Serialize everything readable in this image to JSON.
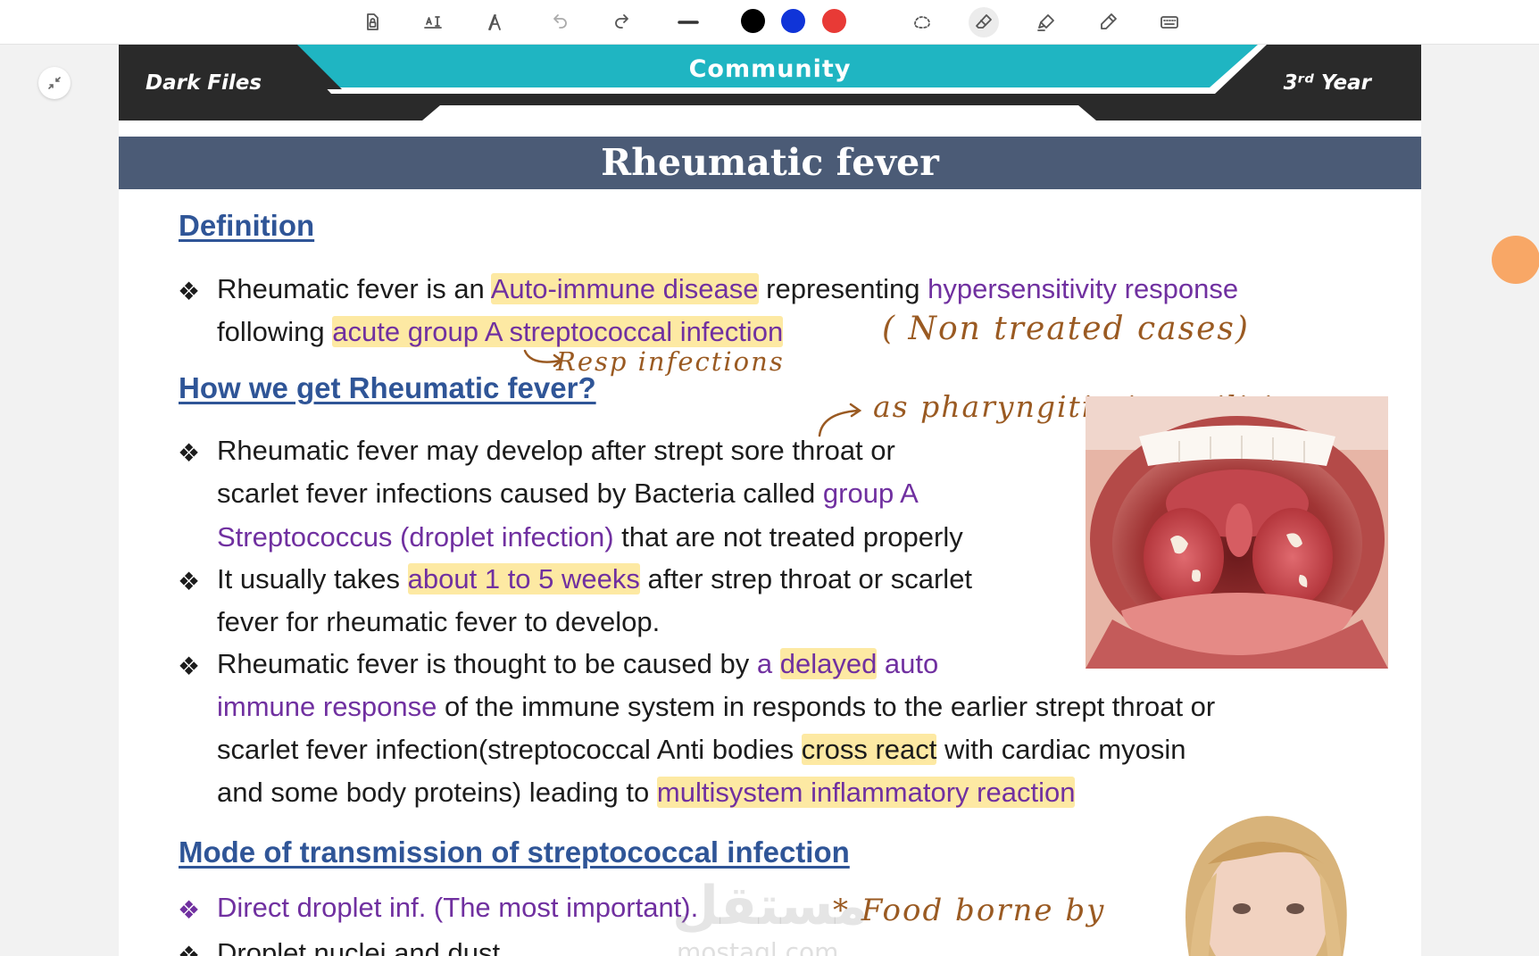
{
  "colors": {
    "ink_black": "#000000",
    "ink_blue": "#1034d8",
    "ink_red": "#e83a36",
    "heading_blue": "#2f5597",
    "accent_purple": "#7030a0",
    "highlight_yellow": "#fde9a3",
    "header_teal": "#1fb5c2",
    "title_bar": "#4b5b76",
    "handwriting": "#9a5a22"
  },
  "toolbar": {
    "tools": [
      "lock-document-icon",
      "text-box-icon",
      "text-style-icon",
      "undo-icon",
      "redo-icon",
      "line-width-icon",
      "black-swatch",
      "blue-swatch",
      "red-swatch",
      "lasso-icon",
      "eraser-icon",
      "highlighter-icon",
      "pen-icon",
      "keyboard-icon"
    ],
    "active_tool": "eraser-icon"
  },
  "header": {
    "left": "Dark Files",
    "center": "Community",
    "right": "3ʳᵈ Year"
  },
  "title": "Rheumatic fever",
  "definition": {
    "heading": "Definition",
    "l1_a": "Rheumatic fever is an ",
    "l1_b": "Auto-immune disease",
    "l1_c": " representing ",
    "l1_d": "hypersensitivity response",
    "l2_a": "following ",
    "l2_b": "acute group A streptococcal infection",
    "note_nontreated": "( Non  treated  cases)",
    "note_resp": "Resp  infections"
  },
  "how": {
    "heading": "How we get Rheumatic fever?",
    "note_pharyngitis": "as  pharyngitis / tonsilitis",
    "b1_l1": "Rheumatic fever may develop after strept sore throat or",
    "b1_l2_a": "scarlet fever infections caused by Bacteria called ",
    "b1_l2_b": "group A",
    "b1_l3_a": "Streptococcus (droplet infection)",
    "b1_l3_b": " that are not treated properly",
    "b2_l1_a": "It usually takes ",
    "b2_l1_b": "about 1 to 5 weeks",
    "b2_l1_c": " after strep throat or scarlet",
    "b2_l2": "fever for rheumatic fever to develop.",
    "b3_l1_a": "Rheumatic fever is thought to be caused by ",
    "b3_l1_b": "a ",
    "b3_l1_c": "delayed",
    "b3_l1_d": " auto",
    "b3_l2_a": "immune response",
    "b3_l2_b": " of  the immune system in responds to the earlier strept throat or",
    "b3_l3_a": "scarlet fever infection(streptococcal Anti bodies ",
    "b3_l3_b": "cross react",
    "b3_l3_c": " with cardiac myosin",
    "b3_l4_a": "and some body proteins) leading to ",
    "b3_l4_b": "multisystem inflammatory reaction"
  },
  "mode": {
    "heading": "Mode of transmission of streptococcal infection",
    "b1": "Direct droplet inf. (The most important).",
    "b2": "Droplet nuclei and dust",
    "note_food": "* Food  borne  by"
  },
  "watermark": {
    "arabic": "مستقل",
    "latin": "mostaql.com"
  }
}
